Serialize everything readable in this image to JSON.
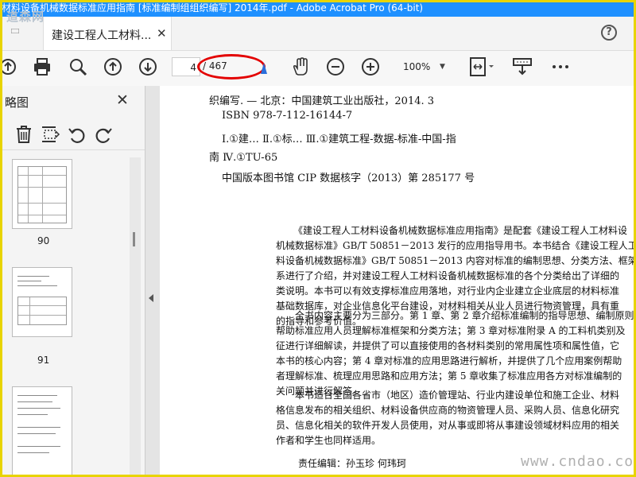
{
  "window": {
    "title": "材料设备机械数据标准应用指南 [标准编制组组织编写] 2014年.pdf - Adobe Acrobat Pro (64-bit)",
    "watermark_logo": "道森网"
  },
  "tabs": [
    {
      "label": "建设工程人工材料...",
      "active": true
    }
  ],
  "toolbar": {
    "current_page": "4",
    "total_pages": "/ 467",
    "zoom": "100%",
    "icons": [
      "upload-icon",
      "print-icon",
      "zoom-search-icon",
      "prev-page-icon",
      "next-page-icon",
      "hand-tool-icon",
      "zoom-out-icon",
      "zoom-in-icon",
      "fit-page-icon",
      "read-mode-icon",
      "more-icon"
    ]
  },
  "annotation": {
    "color": "#e30000"
  },
  "sidebar": {
    "title": "略图",
    "close": "✕",
    "thumbnails": [
      {
        "page": "90"
      },
      {
        "page": "91"
      },
      {
        "page": ""
      }
    ]
  },
  "document": {
    "lines_top": [
      "织编写. — 北京：中国建筑工业出版社，2014. 3",
      "ISBN 978-7-112-16144-7",
      "Ⅰ.①建…  Ⅱ.①标…  Ⅲ.①建筑工程-数据-标准-中国-指",
      "南  Ⅳ.①TU-65",
      "中国版本图书馆 CIP 数据核字（2013）第 285177 号"
    ],
    "paragraph1": [
      "《建设工程人工材料设备机械数据标准应用指南》是配套《建设工程人工材料设",
      "机械数据标准》GB/T 50851－2013 发行的应用指导用书。本书结合《建设工程人工",
      "料设备机械数据标准》GB/T 50851－2013 内容对标准的编制思想、分类方法、框架",
      "系进行了介绍，并对建设工程人工材料设备机械数据标准的各个分类给出了详细的",
      "类说明。本书可以有效支撑标准应用落地，对行业内企业建立企业底层的材料标准",
      "基础数据库，对企业信息化平台建设，对材料相关从业人员进行物资管理，具有重",
      "的指导和参考价值。"
    ],
    "paragraph2": [
      "全书内容主要分为三部分。第 1 章、第 2 章介绍标准编制的指导思想、编制原则",
      "帮助标准应用人员理解标准框架和分类方法；第 3 章对标准附录 A 的工料机类别及",
      "征进行详细解读，并提供了可以直接使用的各材料类别的常用属性项和属性值，它",
      "本书的核心内容；第 4 章对标准的应用思路进行解析，并提供了几个应用案例帮助",
      "者理解标准、梳理应用思路和应用方法；第 5 章收集了标准应用各方对标准编制的",
      "关问题并进行解答。"
    ],
    "paragraph3": [
      "本书适合全国各省市（地区）造价管理站、行业内建设单位和施工企业、材料",
      "格信息发布的相关组织、材料设备供应商的物资管理人员、采购人员、信息化研究",
      "员、信息化相关的软件开发人员使用，对从事或即将从事建设领域材料应用的相关",
      "作者和学生也同样适用。"
    ],
    "editor_line": "责任编辑：孙玉珍   何玮珂"
  },
  "watermark_bottom": "www.cndao.com"
}
